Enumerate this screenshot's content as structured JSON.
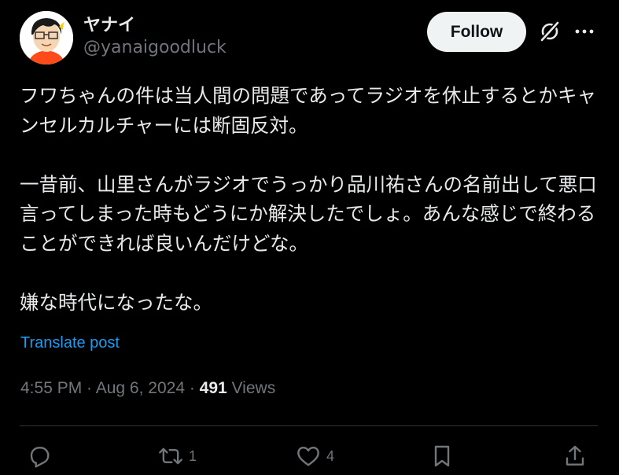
{
  "author": {
    "display_name": "ヤナイ",
    "handle": "@yanaigoodluck",
    "avatar_icon": "cartoon-avatar-icon"
  },
  "header": {
    "follow_label": "Follow",
    "grok_icon": "grok-icon",
    "more_icon": "more-icon"
  },
  "tweet": {
    "paragraph1": "フワちゃんの件は当人間の問題であってラジオを休止するとかキャンセルカルチャーには断固反対。",
    "paragraph2": "一昔前、山里さんがラジオでうっかり品川祐さんの名前出して悪口言ってしまった時もどうにか解決したでしょ。あんな感じで終わることができれば良いんだけどな。",
    "paragraph3": "嫌な時代になったな。",
    "translate_label": "Translate post"
  },
  "meta": {
    "time": "4:55 PM",
    "separator": " · ",
    "date": "Aug 6, 2024",
    "views_count": "491",
    "views_label": " Views"
  },
  "actions": {
    "reply_count": "",
    "repost_count": "1",
    "like_count": "4"
  },
  "colors": {
    "background": "#000000",
    "text": "#e7e9ea",
    "secondary": "#71767b",
    "link": "#1d9bf0",
    "button_bg": "#eff3f4"
  }
}
